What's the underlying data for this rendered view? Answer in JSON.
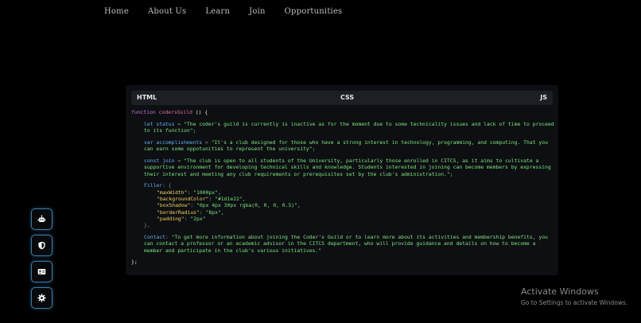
{
  "nav": {
    "items": [
      "Home",
      "About Us",
      "Learn",
      "Join",
      "Opportunities"
    ]
  },
  "tabs": {
    "html": "HTML",
    "css": "CSS",
    "js": "JS"
  },
  "code": {
    "func_keyword": "function",
    "func_name": "codersGuild",
    "func_open": "() {",
    "status": {
      "kw": "let",
      "name": "status",
      "op": "=",
      "value": "\"The coder's guild is currently is inactive as for the moment due to some technicality issues and lack of time to proceed to its function\";"
    },
    "accomplishments": {
      "kw": "var",
      "name": "accomplishments",
      "op": "=",
      "value": "\"It's a club designed for those who have a strong interest in technology, programming, and computing. That you can earn some oppotunities to represent the university\";"
    },
    "join": {
      "kw": "const",
      "name": "join",
      "op": "=",
      "value": "\"The club is open to all students of the University, particularly those enrolled in CITCS, as it aims to cultivate a supportive environment for developing technical skills and knowledge. Students interested in joining can become members by expressing their interest and meeting any club requirements or prerequisites set by the club's administration.\";"
    },
    "filler": {
      "name": "Filler",
      "open": ": {",
      "props": [
        {
          "key": "\"maxWidth\"",
          "value": ": \"1000px\","
        },
        {
          "key": "\"backgroundColor\"",
          "value": ": \"#1d1e22\","
        },
        {
          "key": "\"boxShadow\"",
          "value": ": \"0px 4px 30px rgba(0, 0, 0, 0.5)\","
        },
        {
          "key": "\"borderRadius\"",
          "value": ": \"8px\","
        },
        {
          "key": "\"padding\"",
          "value": ": \"2px\""
        }
      ],
      "close": "},"
    },
    "contact": {
      "name": "Contact",
      "op": ":",
      "value": "\"To get more information about joining the Coder's Guild or to learn more about its activities and membership benefits, you can contact a professor or an academic advisor in the CITCS department, who will provide guidance and details on how to become a member and participate in the club's various initiatives.\""
    },
    "func_close": "};"
  },
  "sidebar": {
    "buttons": [
      {
        "icon": "robot-icon"
      },
      {
        "icon": "shield-icon"
      },
      {
        "icon": "id-card-icon"
      },
      {
        "icon": "gear-icon"
      }
    ]
  },
  "watermark": {
    "title": "Activate Windows",
    "subtitle": "Go to Settings to activate Windows."
  },
  "colors": {
    "background": "#000000",
    "panel": "#0d0f12",
    "tab_bar": "#1c1f24",
    "keyword": "#c678dd",
    "variable": "#61aff0",
    "string": "#7ee37e",
    "property": "#f0d060",
    "button_border": "#3b7ba8"
  }
}
